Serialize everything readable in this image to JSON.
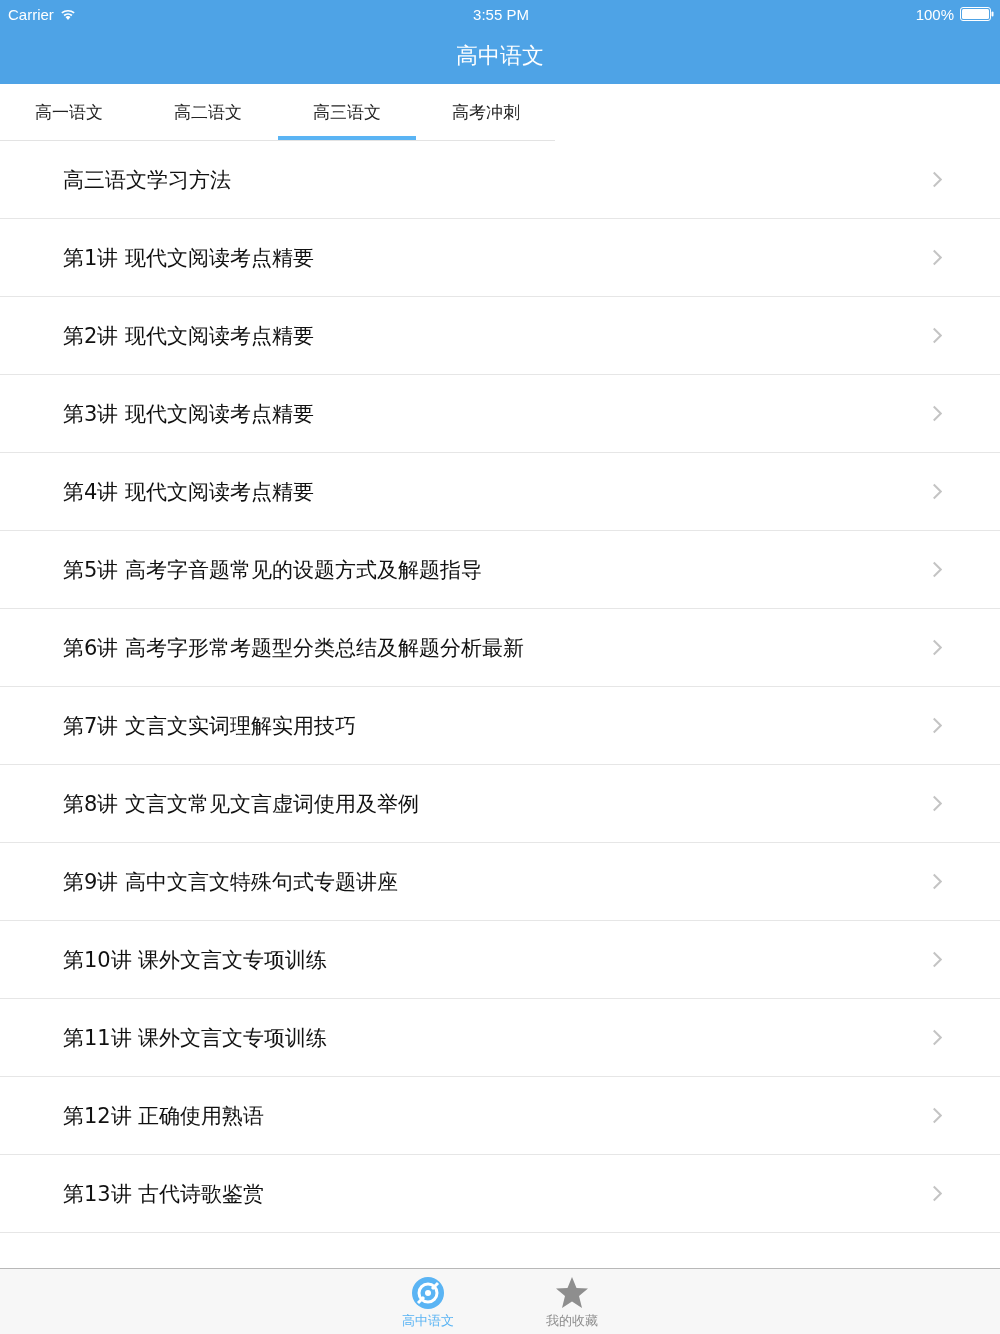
{
  "status_bar": {
    "carrier": "Carrier",
    "time": "3:55 PM",
    "battery": "100%"
  },
  "nav_bar": {
    "title": "高中语文"
  },
  "tabs": [
    {
      "label": "高一语文",
      "selected": false
    },
    {
      "label": "高二语文",
      "selected": false
    },
    {
      "label": "高三语文",
      "selected": true
    },
    {
      "label": "高考冲刺",
      "selected": false
    }
  ],
  "list": [
    {
      "title": "高三语文学习方法"
    },
    {
      "title": "第1讲 现代文阅读考点精要"
    },
    {
      "title": "第2讲 现代文阅读考点精要"
    },
    {
      "title": "第3讲 现代文阅读考点精要"
    },
    {
      "title": "第4讲 现代文阅读考点精要"
    },
    {
      "title": "第5讲 高考字音题常见的设题方式及解题指导"
    },
    {
      "title": "第6讲 高考字形常考题型分类总结及解题分析最新"
    },
    {
      "title": "第7讲 文言文实词理解实用技巧"
    },
    {
      "title": "第8讲 文言文常见文言虚词使用及举例"
    },
    {
      "title": "第9讲 高中文言文特殊句式专题讲座"
    },
    {
      "title": "第10讲 课外文言文专项训练"
    },
    {
      "title": "第11讲 课外文言文专项训练"
    },
    {
      "title": "第12讲 正确使用熟语"
    },
    {
      "title": "第13讲 古代诗歌鉴赏"
    }
  ],
  "tab_bar": [
    {
      "label": "高中语文",
      "kind": "disc",
      "selected": true
    },
    {
      "label": "我的收藏",
      "kind": "star",
      "selected": false
    }
  ]
}
